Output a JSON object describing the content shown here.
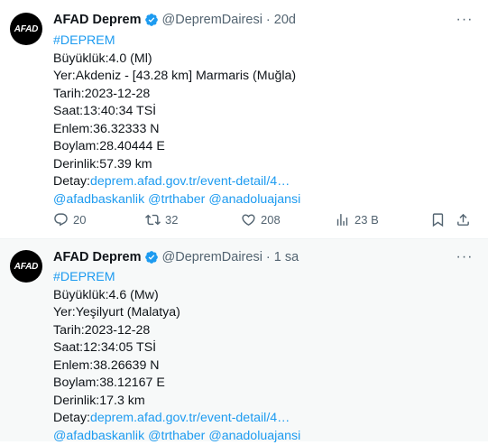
{
  "tweets": [
    {
      "avatar_text": "AFAD",
      "name": "AFAD Deprem",
      "handle": "@DepremDairesi",
      "separator": "·",
      "time": "20d",
      "more": "···",
      "lines": {
        "hashtag": "#DEPREM",
        "magnitude": "Büyüklük:4.0 (Ml)",
        "location": "Yer:Akdeniz - [43.28 km] Marmaris (Muğla)",
        "date": "Tarih:2023-12-28",
        "hour": "Saat:13:40:34 TSİ",
        "lat": "Enlem:36.32333 N",
        "lon": "Boylam:28.40444 E",
        "depth": "Derinlik:57.39 km",
        "detail_prefix": "Detay:",
        "detail_link": "deprem.afad.gov.tr/event-detail/4…",
        "mentions": "@afadbaskanlik @trthaber @anadoluajansi"
      },
      "actions": {
        "replies": "20",
        "retweets": "32",
        "likes": "208",
        "views": "23 B"
      }
    },
    {
      "avatar_text": "AFAD",
      "name": "AFAD Deprem",
      "handle": "@DepremDairesi",
      "separator": "·",
      "time": "1 sa",
      "more": "···",
      "lines": {
        "hashtag": "#DEPREM",
        "magnitude": "Büyüklük:4.6 (Mw)",
        "location": "Yer:Yeşilyurt (Malatya)",
        "date": "Tarih:2023-12-28",
        "hour": "Saat:12:34:05 TSİ",
        "lat": "Enlem:38.26639 N",
        "lon": "Boylam:38.12167 E",
        "depth": "Derinlik:17.3 km",
        "detail_prefix": "Detay:",
        "detail_link": "deprem.afad.gov.tr/event-detail/4…",
        "mentions": "@afadbaskanlik @trthaber @anadoluajansi"
      }
    }
  ],
  "colors": {
    "link": "#1d9bf0",
    "secondary_text": "#536471",
    "verified_badge": "#1d9bf0"
  }
}
